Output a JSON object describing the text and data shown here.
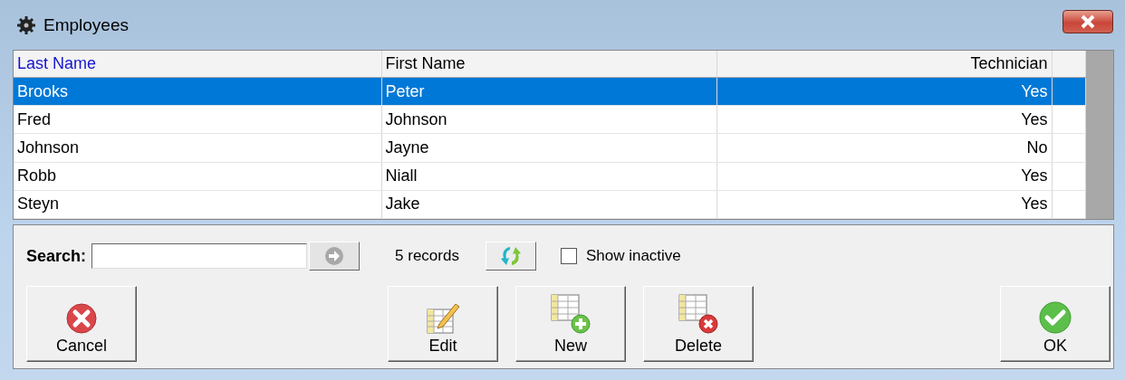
{
  "window": {
    "title": "Employees"
  },
  "table": {
    "columns": [
      {
        "label": "Last Name",
        "selected": true,
        "kind": "text"
      },
      {
        "label": "First Name",
        "selected": false,
        "kind": "text"
      },
      {
        "label": "Technician",
        "selected": false,
        "kind": "flag"
      }
    ],
    "rows": [
      {
        "cells": [
          "Brooks",
          "Peter",
          "Yes"
        ],
        "selected": true
      },
      {
        "cells": [
          "Fred",
          "Johnson",
          "Yes"
        ],
        "selected": false
      },
      {
        "cells": [
          "Johnson",
          "Jayne",
          "No"
        ],
        "selected": false
      },
      {
        "cells": [
          "Robb",
          "Niall",
          "Yes"
        ],
        "selected": false
      },
      {
        "cells": [
          "Steyn",
          "Jake",
          "Yes"
        ],
        "selected": false
      }
    ]
  },
  "search": {
    "label": "Search:"
  },
  "record_count": "5 records",
  "show_inactive": {
    "label": "Show inactive",
    "checked": false
  },
  "buttons": [
    {
      "label": "Cancel",
      "kind": "cancel"
    },
    {
      "label": "Edit",
      "kind": "edit"
    },
    {
      "label": "New",
      "kind": "new"
    },
    {
      "label": "Delete",
      "kind": "delete"
    },
    {
      "label": "OK",
      "kind": "ok"
    }
  ]
}
